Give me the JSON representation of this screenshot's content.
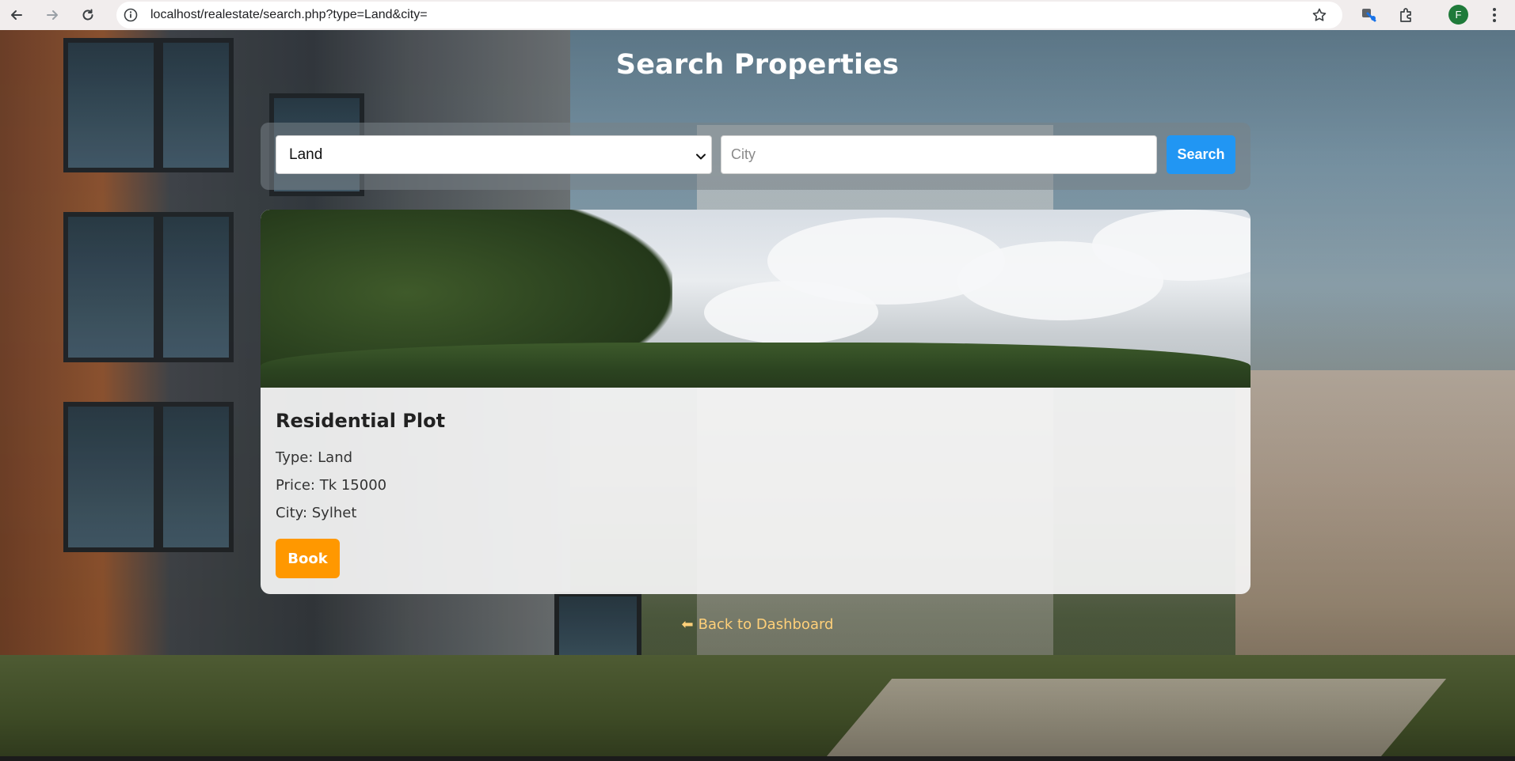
{
  "browser": {
    "url": "localhost/realestate/search.php?type=Land&city=",
    "profile_initial": "F"
  },
  "page": {
    "title": "Search Properties"
  },
  "search": {
    "type_selected": "Land",
    "city_placeholder": "City",
    "city_value": "",
    "search_label": "Search"
  },
  "results": [
    {
      "title": "Residential Plot",
      "type_line": "Type: Land",
      "price_line": "Price: Tk 15000",
      "city_line": "City: Sylhet",
      "book_label": "Book"
    }
  ],
  "footer": {
    "back_arrow": "⬅",
    "back_label": "Back to Dashboard"
  },
  "colors": {
    "search_button": "#2196f3",
    "book_button": "#ff9800",
    "back_link": "#ffd079"
  }
}
